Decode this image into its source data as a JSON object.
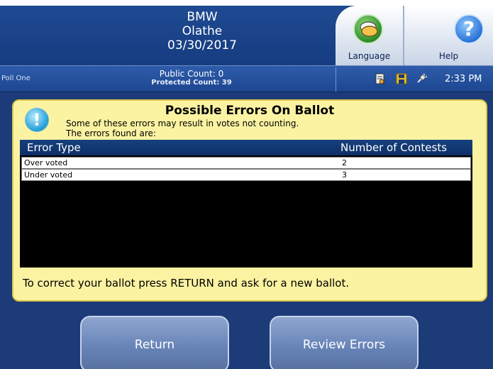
{
  "header": {
    "line1": "BMW",
    "line2": "Olathe",
    "line3": "03/30/2017",
    "language_label": "Language",
    "help_label": "Help",
    "help_glyph": "?"
  },
  "status": {
    "poll_name": "Poll One",
    "public_count": "Public Count: 0",
    "protected_count": "Protected Count: 39",
    "time": "2:33 PM"
  },
  "panel": {
    "warn_glyph": "!",
    "title": "Possible Errors On Ballot",
    "subtitle1": "Some of these errors may result in votes not counting.",
    "subtitle2": "The errors found are:",
    "table": {
      "col_type": "Error Type",
      "col_count": "Number of Contests",
      "rows": [
        {
          "type": "Over voted",
          "count": "2"
        },
        {
          "type": "Under voted",
          "count": "3"
        }
      ]
    },
    "footer": "To correct your ballot press RETURN and ask for a new ballot."
  },
  "buttons": {
    "return_label": "Return",
    "review_label": "Review Errors"
  },
  "icons": [
    "language-icon",
    "help-icon",
    "document-icon",
    "save-icon",
    "power-plug-icon",
    "warning-icon"
  ],
  "colors": {
    "background": "#1d3b78",
    "panel": "#fbf3a2",
    "table_header": "#17407e",
    "button": "#6884b8"
  }
}
